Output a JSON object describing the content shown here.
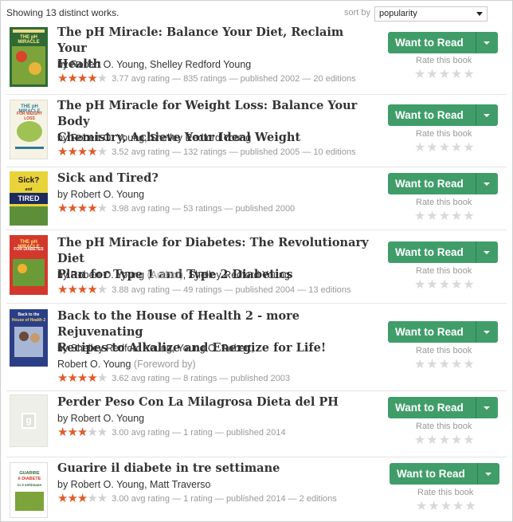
{
  "header": {
    "showing_text": "Showing 13 distinct works.",
    "sort_label": "sort by",
    "sort_value": "popularity"
  },
  "colors": {
    "want_to_read": "#409d69",
    "star_filled": "#e05a2a",
    "star_empty": "#d0d0d0"
  },
  "button": {
    "want_label": "Want to Read",
    "rate_label": "Rate this book"
  },
  "books": [
    {
      "title_line1": "The pH Miracle: Balance Your Diet, Reclaim Your",
      "title_line2": "Health",
      "authors_line1": "by Robert O. Young, Shelley Redford Young",
      "authors_role": "",
      "authors_line2": "",
      "authors_role2": "",
      "rating_text": "3.77 avg rating — 835 ratings — published 2002 — 20 editions",
      "stars_filled": 4,
      "cover": {
        "bg": "#2f6a34",
        "top": "THE pH MIRACLE",
        "sub": ""
      }
    },
    {
      "title_line1": "The pH Miracle for Weight Loss: Balance Your Body",
      "title_line2": "Chemistry, Achieve Your Ideal Weight",
      "authors_line1": "by Robert O. Young, Shelley Redford Young",
      "authors_role": "",
      "authors_line2": "",
      "authors_role2": "",
      "rating_text": "3.52 avg rating — 132 ratings — published 2005 — 10 editions",
      "stars_filled": 4,
      "cover": {
        "bg": "#f6f3e4",
        "top": "THE pH MIRACLE",
        "sub": "FOR WEIGHT LOSS"
      }
    },
    {
      "title_line1": "Sick and Tired?",
      "title_line2": "",
      "authors_line1": "by Robert O. Young",
      "authors_role": "",
      "authors_line2": "",
      "authors_role2": "",
      "rating_text": "3.98 avg rating — 53 ratings — published 2000",
      "stars_filled": 4,
      "cover": {
        "bg": "#e9d33b",
        "top": "Sick? and",
        "sub": "TIRED"
      }
    },
    {
      "title_line1": "The pH Miracle for Diabetes: The Revolutionary Diet",
      "title_line2": "Plan for Type 1 and Type 2 Diabetics",
      "authors_line1": "by Robert O. Young ",
      "authors_role": "(Author)",
      "authors_line1b": ", Shelley Redford Young",
      "authors_line2": "",
      "authors_role2": "",
      "rating_text": "3.88 avg rating — 49 ratings — published 2004 — 13 editions",
      "stars_filled": 4,
      "cover": {
        "bg": "#d3382c",
        "top": "THE pH MIRACLE",
        "sub": "FOR DIABETES"
      }
    },
    {
      "title_line1": "Back to the House of Health 2 - more Rejuvenating",
      "title_line2": "Recipes to Alkalize and Energize for Life!",
      "authors_line1": "by Shelley Redford Young, Young O. Robert,",
      "authors_role": "",
      "authors_line2": "Robert O. Young ",
      "authors_role2": "(Foreword by)",
      "rating_text": "3.62 avg rating — 8 ratings — published 2003",
      "stars_filled": 4,
      "cover": {
        "bg": "#2c3f86",
        "top": "Back to the",
        "sub": "House of Health 2"
      }
    },
    {
      "title_line1": "Perder Peso Con La Milagrosa Dieta del PH",
      "title_line2": "",
      "authors_line1": "by Robert O. Young",
      "authors_role": "",
      "authors_line2": "",
      "authors_role2": "",
      "rating_text": "3.00 avg rating — 1 rating — published 2014",
      "stars_filled": 3,
      "cover": {
        "bg": "#efefea",
        "top": "g",
        "sub": ""
      }
    },
    {
      "title_line1": "Guarire il diabete in tre settimane",
      "title_line2": "",
      "authors_line1": "by Robert O. Young, Matt Traverso",
      "authors_role": "",
      "authors_line2": "",
      "authors_role2": "",
      "rating_text": "3.00 avg rating — 1 rating — published 2014 — 2 editions",
      "stars_filled": 3,
      "cover": {
        "bg": "#ffffff",
        "top": "GUARIRE il DIABETE",
        "sub": "in 3 settimane"
      }
    }
  ]
}
